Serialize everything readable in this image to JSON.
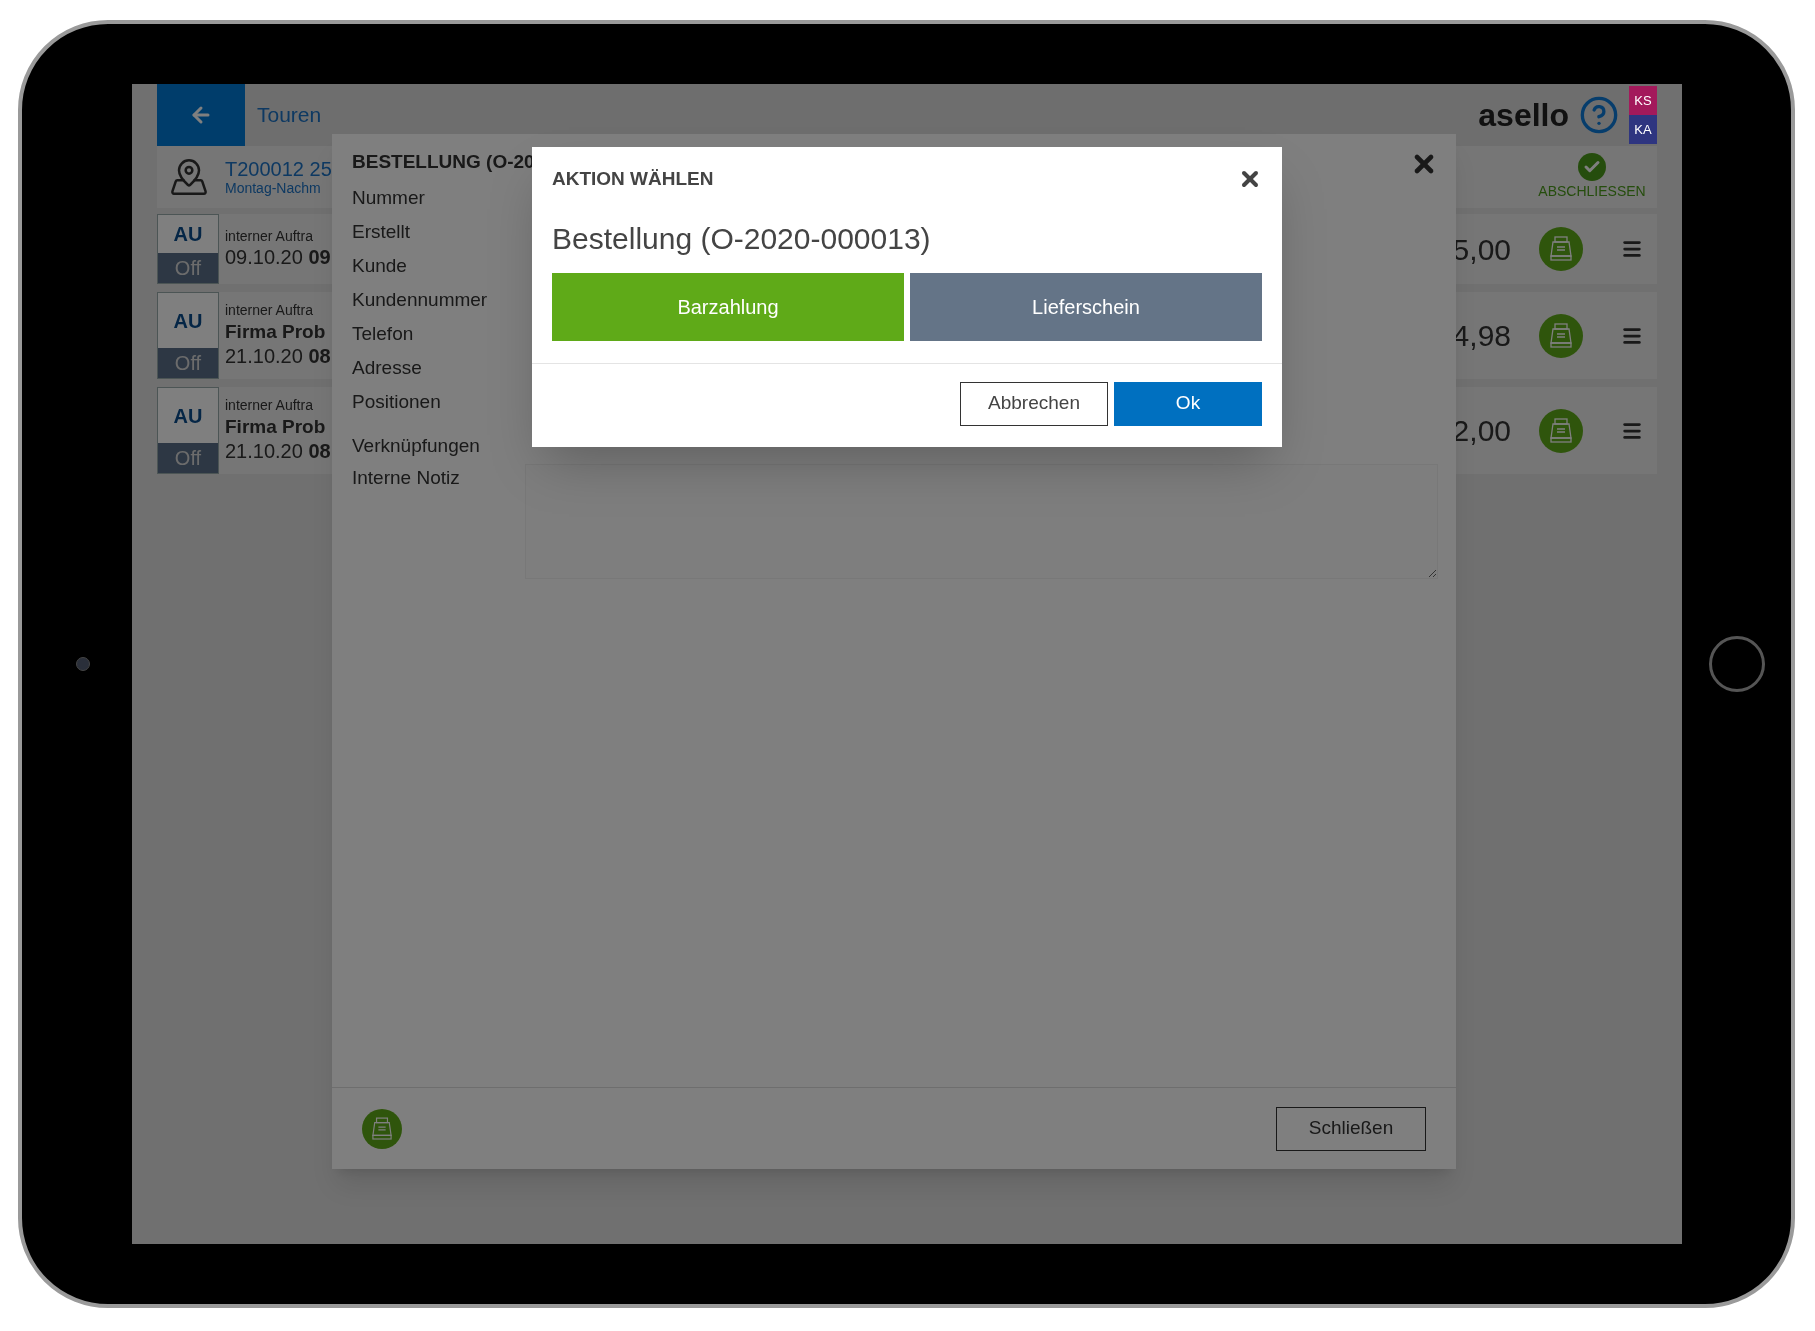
{
  "header": {
    "back_label": "Touren",
    "logo": "asello",
    "badges": [
      {
        "label": "KS",
        "color": "#a3195b"
      },
      {
        "label": "KA",
        "color": "#2e3580"
      }
    ]
  },
  "tour": {
    "number": "T200012 25",
    "subtitle": "Montag-Nachm",
    "action": "ABSCHLIESSEN"
  },
  "orders": [
    {
      "type": "AU",
      "status": "Off",
      "kind_label": "interner Auftra",
      "date": "09.10.20 **09**",
      "amount": "5,00"
    },
    {
      "type": "AU",
      "status": "Off",
      "kind_label": "interner Auftra",
      "company": "Firma Prob",
      "date": "21.10.20 **08**",
      "amount": "4,98"
    },
    {
      "type": "AU",
      "status": "Off",
      "kind_label": "interner Auftra",
      "company": "Firma Prob",
      "date": "21.10.20 **08**",
      "amount": "2,00"
    }
  ],
  "detail_modal": {
    "title": "BESTELLUNG (O-20",
    "fields": [
      "Nummer",
      "Erstellt",
      "Kunde",
      "Kundennummer",
      "Telefon",
      "Adresse",
      "Positionen"
    ],
    "links_label": "Verknüpfungen",
    "note_label": "Interne Notiz",
    "close_button": "Schließen"
  },
  "dialog": {
    "title": "AKTION WÄHLEN",
    "heading": "Bestellung (O-2020-000013)",
    "actions": [
      {
        "label": "Barzahlung",
        "color": "#5faa18"
      },
      {
        "label": "Lieferschein",
        "color": "#647487"
      }
    ],
    "cancel": "Abbrechen",
    "ok": "Ok"
  }
}
